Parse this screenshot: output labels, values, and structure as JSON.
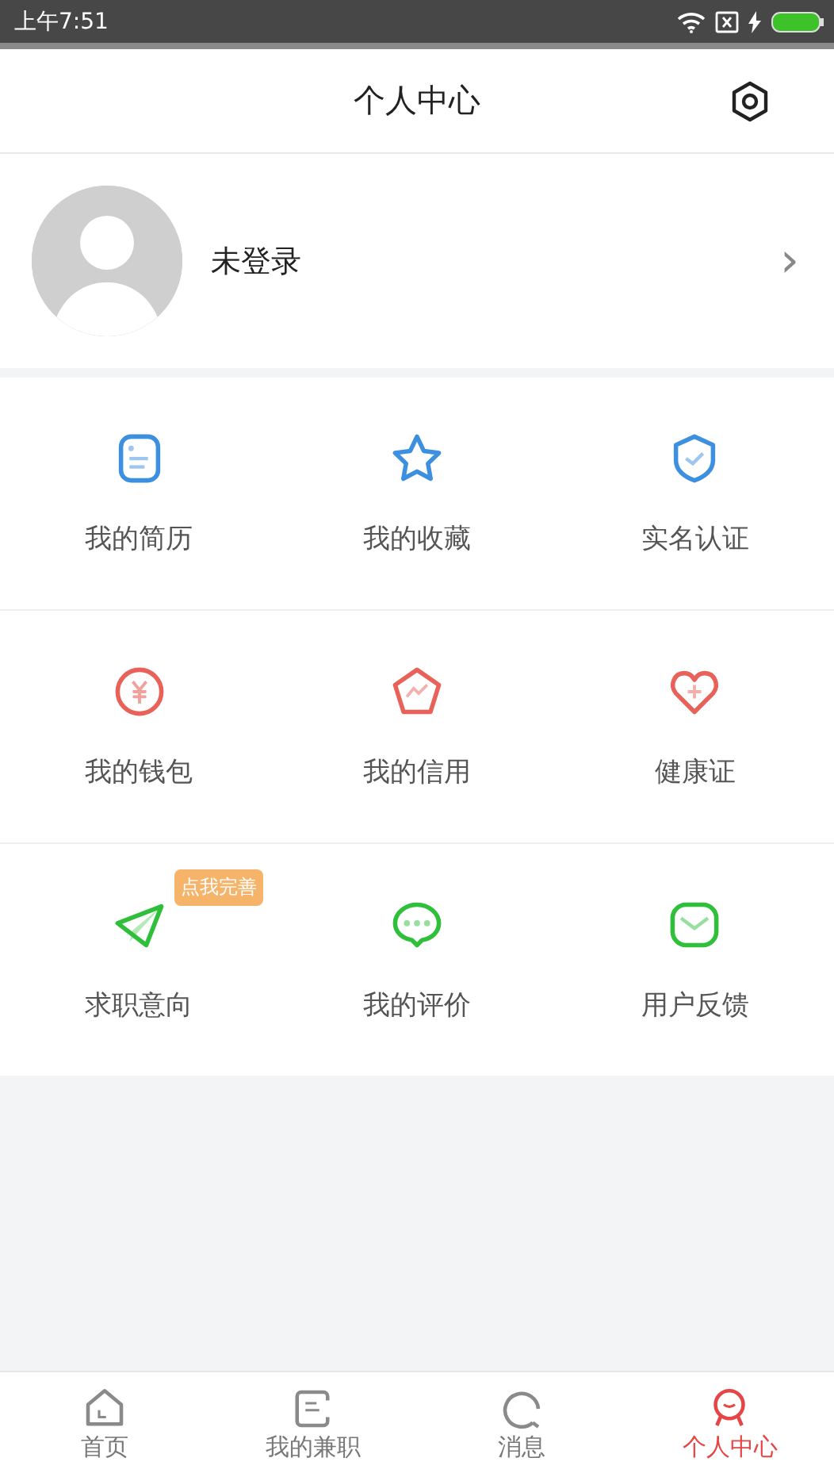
{
  "status_bar": {
    "time": "上午7:51"
  },
  "header": {
    "title": "个人中心"
  },
  "profile": {
    "name": "未登录",
    "chevron": "›"
  },
  "grid": [
    {
      "label": "我的简历",
      "kind": "resume",
      "color": "#3d8fe0"
    },
    {
      "label": "我的收藏",
      "kind": "star",
      "color": "#3d8fe0"
    },
    {
      "label": "实名认证",
      "kind": "shield",
      "color": "#3d8fe0"
    },
    {
      "label": "我的钱包",
      "kind": "wallet",
      "color": "#e8625a"
    },
    {
      "label": "我的信用",
      "kind": "credit",
      "color": "#e8625a"
    },
    {
      "label": "健康证",
      "kind": "health",
      "color": "#e8625a"
    },
    {
      "label": "求职意向",
      "kind": "plane",
      "color": "#2fbf3a",
      "badge": "点我完善"
    },
    {
      "label": "我的评价",
      "kind": "comment",
      "color": "#2fbf3a"
    },
    {
      "label": "用户反馈",
      "kind": "mail",
      "color": "#2fbf3a"
    }
  ],
  "tabs": [
    {
      "label": "首页",
      "kind": "home",
      "selected": false
    },
    {
      "label": "我的兼职",
      "kind": "doc",
      "selected": false
    },
    {
      "label": "消息",
      "kind": "chat",
      "selected": false
    },
    {
      "label": "个人中心",
      "kind": "person",
      "selected": true
    }
  ]
}
